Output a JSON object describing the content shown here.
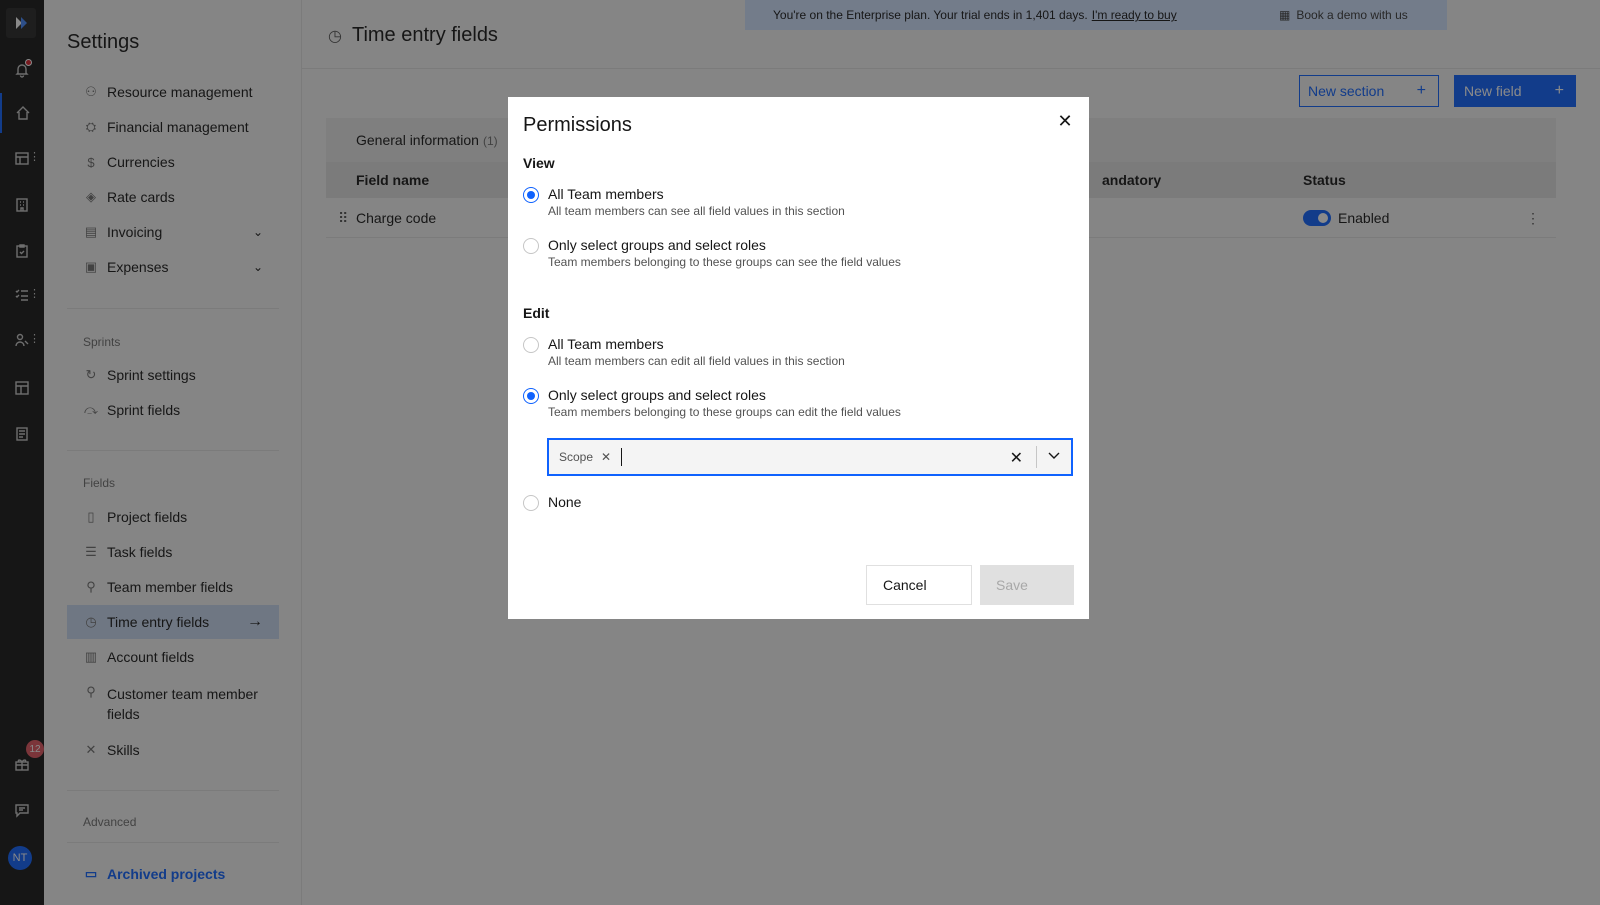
{
  "banner": {
    "text": "You're on the Enterprise plan. Your trial ends in 1,401 days.",
    "link": "I'm ready to buy",
    "demo": "Book a demo with us"
  },
  "rail": {
    "badge_count": "12",
    "avatar_initials": "NT"
  },
  "sidebar": {
    "title": "Settings",
    "items_top": [
      {
        "label": "Resource management",
        "icon": "resource-icon"
      },
      {
        "label": "Financial management",
        "icon": "finance-icon"
      },
      {
        "label": "Currencies",
        "icon": "currency-icon"
      },
      {
        "label": "Rate cards",
        "icon": "tag-icon"
      },
      {
        "label": "Invoicing",
        "icon": "invoice-icon"
      },
      {
        "label": "Expenses",
        "icon": "wallet-icon"
      }
    ],
    "group_sprints": "Sprints",
    "items_sprints": [
      {
        "label": "Sprint settings"
      },
      {
        "label": "Sprint fields"
      }
    ],
    "group_fields": "Fields",
    "items_fields": [
      {
        "label": "Project fields"
      },
      {
        "label": "Task fields"
      },
      {
        "label": "Team member fields"
      },
      {
        "label": "Time entry fields"
      },
      {
        "label": "Account fields"
      },
      {
        "label": "Customer team member fields"
      },
      {
        "label": "Skills"
      }
    ],
    "group_advanced": "Advanced",
    "archived": "Archived projects"
  },
  "main": {
    "title": "Time entry fields",
    "new_section": "New section",
    "new_field": "New field",
    "section_tab": "General information",
    "section_count": "(1)",
    "columns": {
      "field_name": "Field name",
      "mandatory": "andatory",
      "status": "Status"
    },
    "row": {
      "field_name": "Charge code",
      "status": "Enabled"
    }
  },
  "modal": {
    "title": "Permissions",
    "view_heading": "View",
    "view_options": [
      {
        "title": "All Team members",
        "desc": "All team members can see all field values in this section",
        "checked": true
      },
      {
        "title": "Only select groups and select roles",
        "desc": "Team members belonging to these groups can see the field values",
        "checked": false
      }
    ],
    "edit_heading": "Edit",
    "edit_options": [
      {
        "title": "All Team members",
        "desc": "All team members can edit all field values in this section",
        "checked": false
      },
      {
        "title": "Only select groups and select roles",
        "desc": "Team members belonging to these groups can edit the field values",
        "checked": true
      }
    ],
    "tag": "Scope",
    "none_option": "None",
    "cancel": "Cancel",
    "save": "Save"
  }
}
